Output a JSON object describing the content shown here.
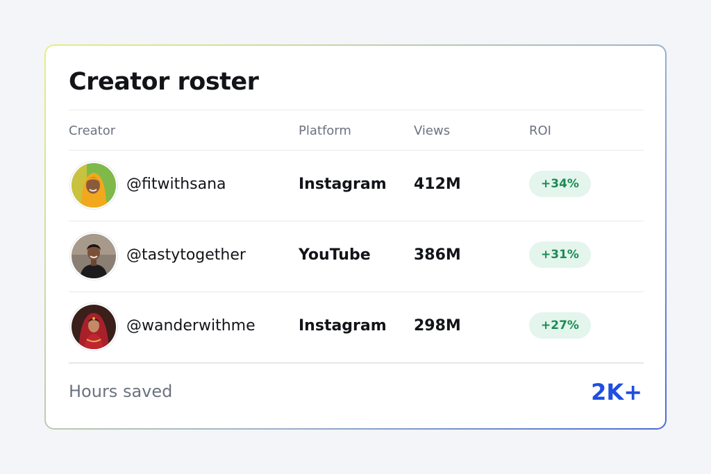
{
  "card": {
    "title": "Creator roster",
    "columns": {
      "creator": "Creator",
      "platform": "Platform",
      "views": "Views",
      "roi": "ROI"
    },
    "rows": [
      {
        "handle": "@fitwithsana",
        "platform": "Instagram",
        "views": "412M",
        "roi": "+34%",
        "avatar_icon": "avatar-photo-icon"
      },
      {
        "handle": "@tastytogether",
        "platform": "YouTube",
        "views": "386M",
        "roi": "+31%",
        "avatar_icon": "avatar-photo-icon"
      },
      {
        "handle": "@wanderwithme",
        "platform": "Instagram",
        "views": "298M",
        "roi": "+27%",
        "avatar_icon": "avatar-photo-icon"
      }
    ],
    "footer": {
      "label": "Hours saved",
      "value": "2K+"
    }
  },
  "colors": {
    "accent": "#1f4ee0",
    "roi_badge_bg": "#e3f5ec",
    "roi_badge_text": "#1d8a54"
  }
}
